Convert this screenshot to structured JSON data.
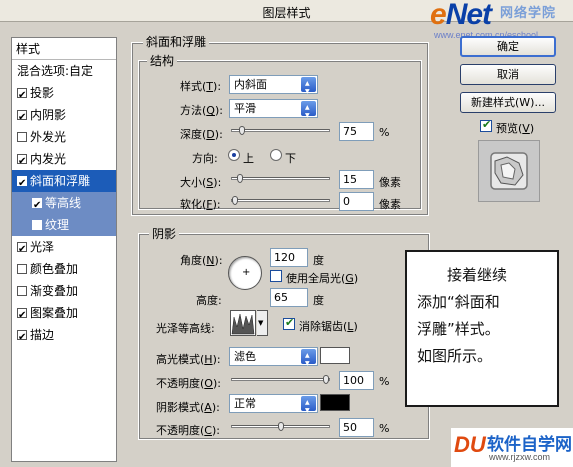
{
  "window": {
    "title": "图层样式"
  },
  "watermark_top": {
    "logo_e": "e",
    "logo_rest": "Net",
    "cn": "网络学院",
    "url": "www.enet.com.cn/eschool"
  },
  "style_list": {
    "header": "样式",
    "blend_options": "混合选项:自定",
    "items": [
      {
        "label": "投影",
        "checked": true
      },
      {
        "label": "内阴影",
        "checked": true
      },
      {
        "label": "外发光",
        "checked": false
      },
      {
        "label": "内发光",
        "checked": true
      },
      {
        "label": "斜面和浮雕",
        "checked": true,
        "selected": true
      },
      {
        "label": "等高线",
        "checked": true,
        "sub": true
      },
      {
        "label": "纹理",
        "checked": false,
        "sub": true
      },
      {
        "label": "光泽",
        "checked": true
      },
      {
        "label": "颜色叠加",
        "checked": false
      },
      {
        "label": "渐变叠加",
        "checked": false
      },
      {
        "label": "图案叠加",
        "checked": true
      },
      {
        "label": "描边",
        "checked": true
      }
    ]
  },
  "bevel": {
    "section_title": "斜面和浮雕",
    "structure_title": "结构",
    "style_label": "样式(",
    "style_key": "T",
    "style_value": "内斜面",
    "technique_label": "方法(",
    "technique_key": "Q",
    "technique_value": "平滑",
    "depth_label": "深度(",
    "depth_key": "D",
    "depth_value": "75",
    "depth_unit": "%",
    "depth_level": 0.075,
    "direction_label": "方向:",
    "direction_up": "上",
    "direction_down": "下",
    "size_label": "大小(",
    "size_key": "S",
    "size_value": "15",
    "size_unit": "像素",
    "size_level": 0.06,
    "soften_label": "软化(",
    "soften_key": "F",
    "soften_value": "0",
    "soften_unit": "像素",
    "soften_level": 0.0
  },
  "shading": {
    "title": "阴影",
    "angle_label": "角度(",
    "angle_key": "N",
    "angle_value": "120",
    "angle_unit": "度",
    "global_light": "使用全局光(",
    "global_light_key": "G",
    "altitude_label": "高度:",
    "altitude_value": "65",
    "altitude_unit": "度",
    "gloss_label": "光泽等高线:",
    "antialias": "消除锯齿(",
    "antialias_key": "L",
    "highlight_mode_label": "高光模式(",
    "highlight_mode_key": "H",
    "highlight_mode_value": "滤色",
    "highlight_color": "#ffffff",
    "hl_opacity_label": "不透明度(",
    "hl_opacity_key": "O",
    "hl_opacity_value": "100",
    "hl_opacity_unit": "%",
    "hl_opacity_level": 1.0,
    "shadow_mode_label": "阴影模式(",
    "shadow_mode_key": "A",
    "shadow_mode_value": "正常",
    "shadow_color": "#000000",
    "sh_opacity_label": "不透明度(",
    "sh_opacity_key": "C",
    "sh_opacity_value": "50",
    "sh_opacity_unit": "%",
    "sh_opacity_level": 0.5
  },
  "buttons": {
    "ok": "确定",
    "cancel": "取消",
    "new_style": "新建样式(W)...",
    "preview_label": "预览(",
    "preview_key": "V"
  },
  "note": {
    "lines": [
      "接着继续",
      "添加“斜面和",
      "浮雕”样式。",
      "如图所示。"
    ]
  },
  "watermark_bottom": {
    "logo": "DU",
    "cn": "软件自学网",
    "url": "www.rjzxw.com"
  }
}
